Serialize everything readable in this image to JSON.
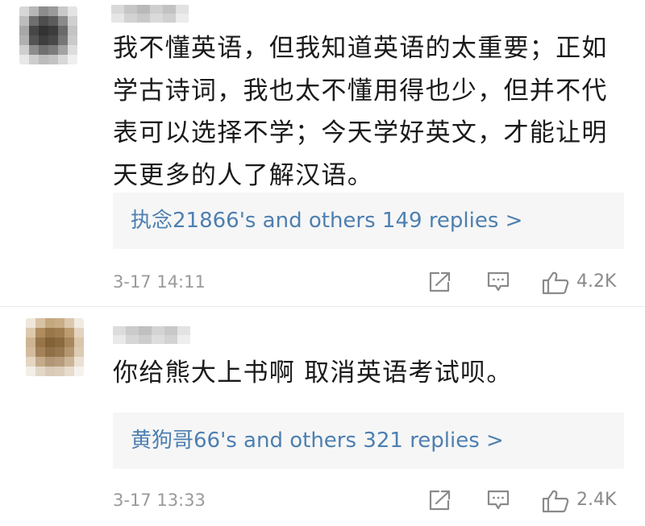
{
  "comments": [
    {
      "text": "我不懂英语，但我知道英语的太重要；正如学古诗词，我也太不懂用得也少，但并不代表可以选择不学；今天学好英文，才能让明天更多的人了解汉语。",
      "replies_summary": "执念21866's and others 149 replies >",
      "timestamp": "3-17 14:11",
      "likes": "4.2K",
      "icons": [
        "share-icon",
        "reply-icon",
        "thumbs-up-icon"
      ]
    },
    {
      "text": "你给熊大上书啊 取消英语考试呗。",
      "replies_summary": "黄狗哥66's and others 321 replies >",
      "timestamp": "3-17 13:33",
      "likes": "2.4K",
      "icons": [
        "share-icon",
        "reply-icon",
        "thumbs-up-icon"
      ]
    }
  ],
  "colors": {
    "link": "#4d7fb0",
    "reply_box": "#f6f6f6",
    "meta_text": "#9a9a9a",
    "icon": "#8a8a8a"
  }
}
